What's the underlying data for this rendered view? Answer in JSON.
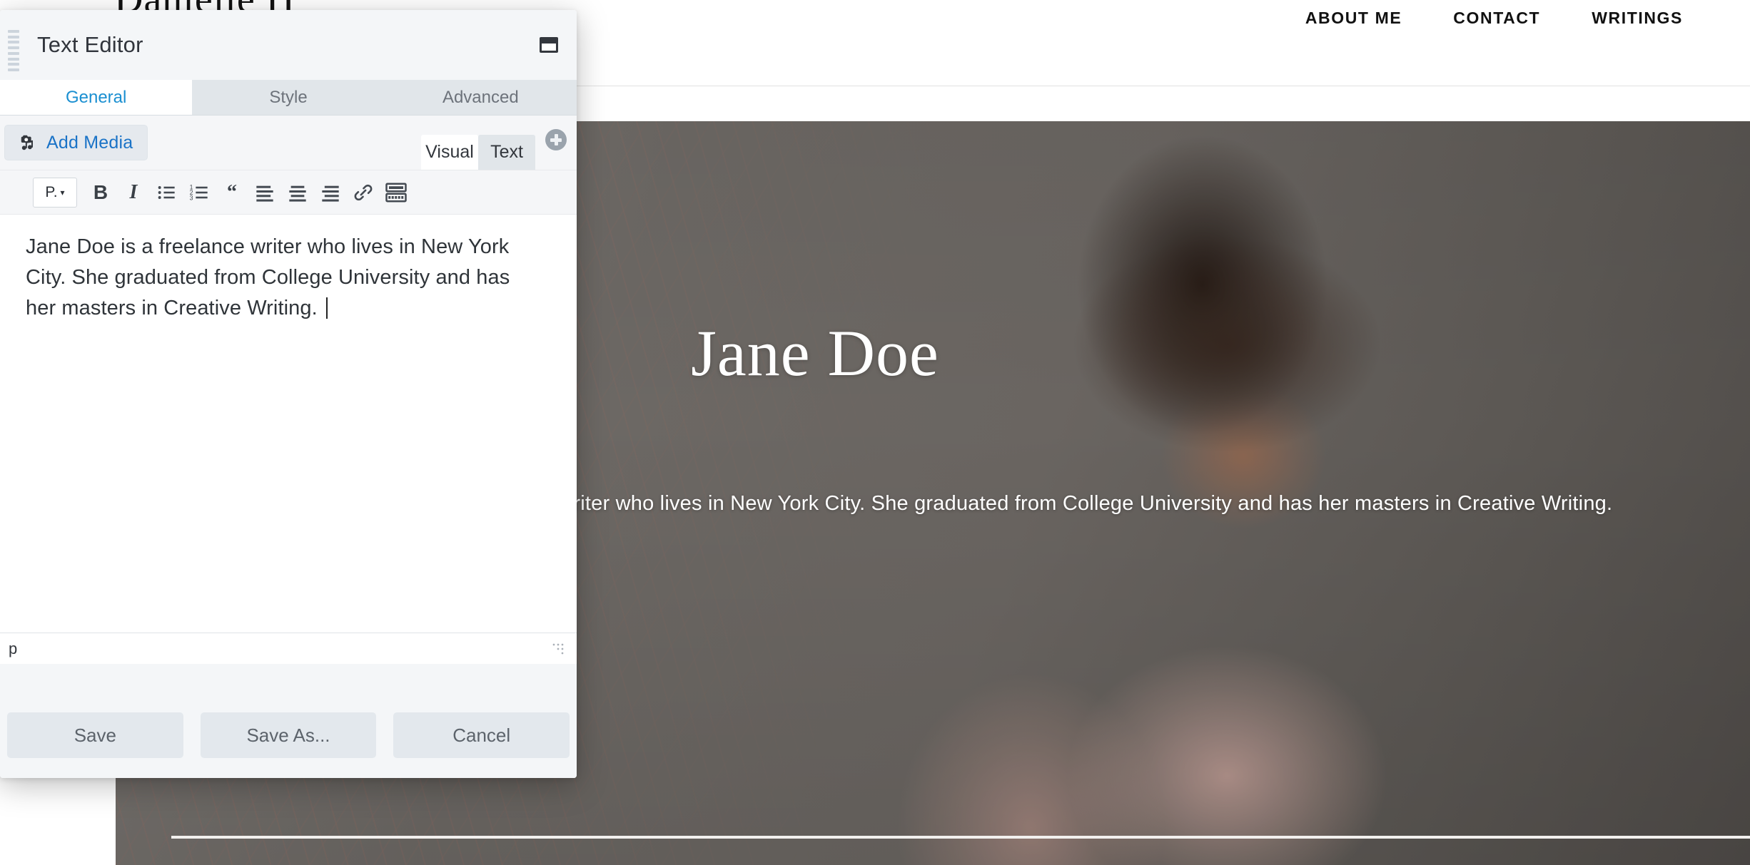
{
  "site": {
    "logo": "Danielle H",
    "nav": [
      {
        "label": "ABOUT ME"
      },
      {
        "label": "CONTACT"
      },
      {
        "label": "WRITINGS"
      }
    ],
    "hero": {
      "title": "Jane Doe",
      "body": "Jane Doe is a freelance writer who lives in New York City. She graduated from College University and has her masters in Creative Writing."
    }
  },
  "panel": {
    "title": "Text Editor",
    "window_icon": "window-restore-icon",
    "drag_handle_icon": "drag-grip-icon",
    "tabs": [
      {
        "label": "General",
        "active": true
      },
      {
        "label": "Style",
        "active": false
      },
      {
        "label": "Advanced",
        "active": false
      }
    ],
    "media": {
      "add_media_label": "Add Media",
      "add_media_icon": "camera-music-icon"
    },
    "mode_tabs": [
      {
        "label": "Visual",
        "active": false
      },
      {
        "label": "Text",
        "active": true
      }
    ],
    "add_button_icon": "plus-circle-icon",
    "toolbar": [
      {
        "name": "paragraph-format-select",
        "label": "P.",
        "caret": "▾",
        "icon": "paragraph-dropdown-icon"
      },
      {
        "name": "bold-button",
        "label": "B",
        "icon": "bold-icon"
      },
      {
        "name": "italic-button",
        "label": "I",
        "icon": "italic-icon"
      },
      {
        "name": "bulleted-list-button",
        "label": "",
        "icon": "bulleted-list-icon"
      },
      {
        "name": "numbered-list-button",
        "label": "",
        "icon": "numbered-list-icon"
      },
      {
        "name": "blockquote-button",
        "label": "“",
        "icon": "blockquote-icon"
      },
      {
        "name": "align-left-button",
        "label": "",
        "icon": "align-left-icon"
      },
      {
        "name": "align-center-button",
        "label": "",
        "icon": "align-center-icon"
      },
      {
        "name": "align-right-button",
        "label": "",
        "icon": "align-right-icon"
      },
      {
        "name": "insert-link-button",
        "label": "",
        "icon": "link-icon"
      },
      {
        "name": "toolbar-toggle-button",
        "label": "",
        "icon": "keyboard-toolbar-icon"
      }
    ],
    "editor": {
      "content": "Jane Doe is a freelance writer who lives in New York City. She graduated from College University and has her masters in Creative Writing. "
    },
    "status": {
      "path": "p",
      "resize_icon": "resize-grip-icon"
    },
    "footer": [
      {
        "label": "Save",
        "name": "save-button"
      },
      {
        "label": "Save As...",
        "name": "save-as-button"
      },
      {
        "label": "Cancel",
        "name": "cancel-button"
      }
    ]
  },
  "colors": {
    "accent_blue": "#1a8fd1",
    "link_blue": "#1a73c7",
    "panel_header_bg": "#f4f6f8",
    "tab_inactive_bg": "#e1e6ea",
    "button_bg": "#e3e8ed",
    "text_dark": "#2f3439"
  }
}
